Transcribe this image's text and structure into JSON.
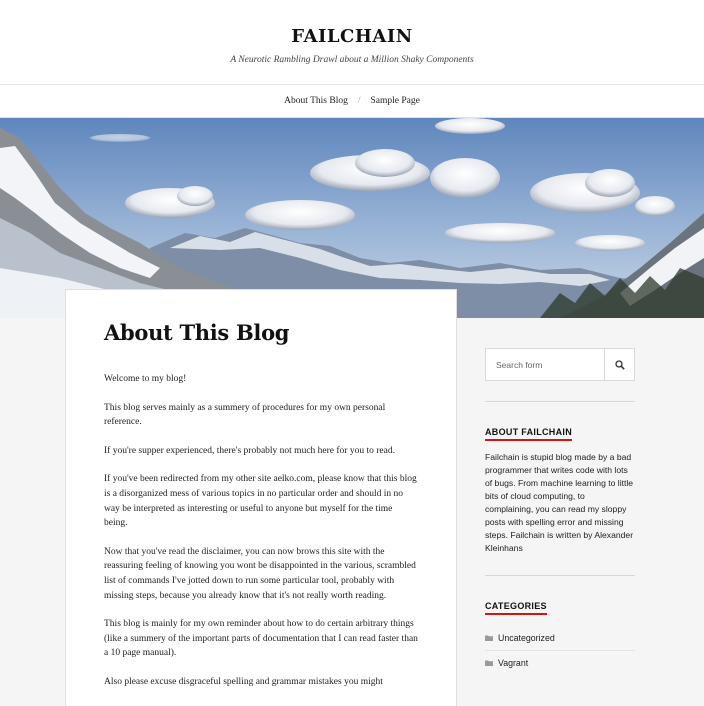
{
  "header": {
    "site_title": "FAILCHAIN",
    "site_description": "A Neurotic Rambling Drawl about a Million Shaky Components"
  },
  "nav": {
    "items": [
      {
        "label": "About This Blog"
      },
      {
        "label": "Sample Page"
      }
    ],
    "separator": "/"
  },
  "hero": {
    "image_icon": "mountain-landscape-image"
  },
  "post": {
    "title": "About This Blog",
    "paragraphs": [
      "Welcome to my blog!",
      "This blog serves mainly as a summery of procedures for my own personal reference.",
      "If you're supper experienced, there's probably not much here for you to read.",
      "If you've been redirected from my other site aelko.com, please know that this blog is a disorganized mess of various topics in no particular order and should in no way be interpreted as interesting or useful to anyone but myself for the time being.",
      "Now that you've read the disclaimer, you can now brows this site with the reassuring feeling of knowing you wont be disappointed in the various, scrambled list of commands I've jotted down to run some particular tool, probably with missing steps, because you already know that it's not really worth reading.",
      "This blog is mainly for my own reminder about how to do certain arbitrary things (like a summery of the important parts of documentation that I can read faster than a 10 page manual).",
      "Also please excuse disgraceful spelling and grammar mistakes you might"
    ]
  },
  "sidebar": {
    "search": {
      "placeholder": "Search form",
      "icon": "search-icon"
    },
    "about": {
      "title": "ABOUT FAILCHAIN",
      "text": "Failchain is stupid blog made by a bad programmer that writes code with lots of bugs. From machine learning to little bits of cloud computing, to complaining, you can read my sloppy posts with spelling error and missing steps. Failchain is written by Alexander Kleinhans"
    },
    "categories": {
      "title": "CATEGORIES",
      "icon": "folder-icon",
      "items": [
        {
          "label": "Uncategorized"
        },
        {
          "label": "Vagrant"
        }
      ]
    }
  },
  "colors": {
    "accent": "#d11414",
    "background": "#f5f5f5",
    "panel": "#ffffff"
  }
}
